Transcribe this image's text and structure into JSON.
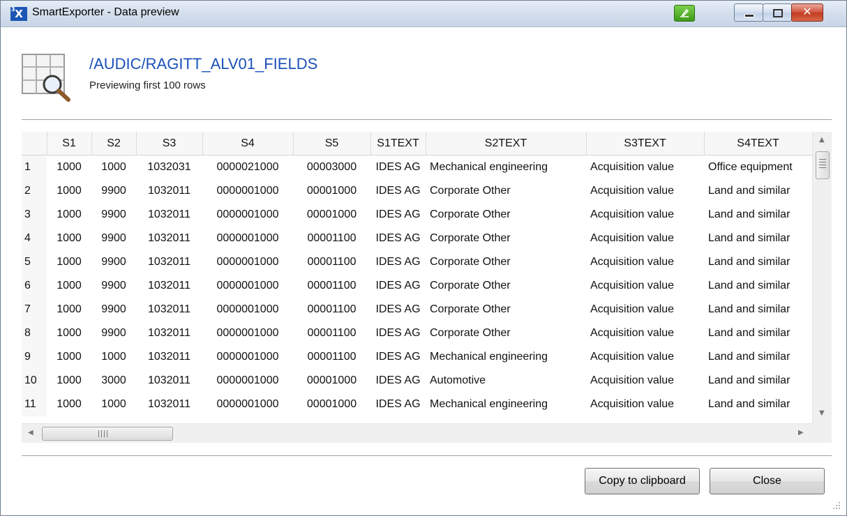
{
  "window": {
    "title": "SmartExporter - Data preview",
    "logo_text": "X",
    "logo_sup": "3",
    "close_glyph": "✕"
  },
  "header": {
    "title": "/AUDIC/RAGITT_ALV01_FIELDS",
    "subtitle": "Previewing first 100 rows"
  },
  "grid": {
    "columns": [
      "S1",
      "S2",
      "S3",
      "S4",
      "S5",
      "S1TEXT",
      "S2TEXT",
      "S3TEXT",
      "S4TEXT"
    ],
    "rows": [
      [
        "1",
        "1000",
        "1000",
        "1032031",
        "0000021000",
        "00003000",
        "IDES AG",
        "Mechanical engineering",
        "Acquisition value",
        "Office equipment"
      ],
      [
        "2",
        "1000",
        "9900",
        "1032011",
        "0000001000",
        "00001000",
        "IDES AG",
        "Corporate Other",
        "Acquisition value",
        "Land and similar"
      ],
      [
        "3",
        "1000",
        "9900",
        "1032011",
        "0000001000",
        "00001000",
        "IDES AG",
        "Corporate Other",
        "Acquisition value",
        "Land and similar"
      ],
      [
        "4",
        "1000",
        "9900",
        "1032011",
        "0000001000",
        "00001100",
        "IDES AG",
        "Corporate Other",
        "Acquisition value",
        "Land and similar"
      ],
      [
        "5",
        "1000",
        "9900",
        "1032011",
        "0000001000",
        "00001100",
        "IDES AG",
        "Corporate Other",
        "Acquisition value",
        "Land and similar"
      ],
      [
        "6",
        "1000",
        "9900",
        "1032011",
        "0000001000",
        "00001100",
        "IDES AG",
        "Corporate Other",
        "Acquisition value",
        "Land and similar"
      ],
      [
        "7",
        "1000",
        "9900",
        "1032011",
        "0000001000",
        "00001100",
        "IDES AG",
        "Corporate Other",
        "Acquisition value",
        "Land and similar"
      ],
      [
        "8",
        "1000",
        "9900",
        "1032011",
        "0000001000",
        "00001100",
        "IDES AG",
        "Corporate Other",
        "Acquisition value",
        "Land and similar"
      ],
      [
        "9",
        "1000",
        "1000",
        "1032011",
        "0000001000",
        "00001100",
        "IDES AG",
        "Mechanical engineering",
        "Acquisition value",
        "Land and similar"
      ],
      [
        "10",
        "1000",
        "3000",
        "1032011",
        "0000001000",
        "00001000",
        "IDES AG",
        "Automotive",
        "Acquisition value",
        "Land and similar"
      ],
      [
        "11",
        "1000",
        "1000",
        "1032011",
        "0000001000",
        "00001000",
        "IDES AG",
        "Mechanical engineering",
        "Acquisition value",
        "Land and similar"
      ]
    ]
  },
  "buttons": {
    "copy": "Copy to clipboard",
    "close": "Close"
  },
  "colors": {
    "title_blue": "#1a50b8",
    "close_red": "#c23a20",
    "pin_green": "#3e9a1a"
  },
  "icons": {
    "logo": "smartexporter-logo-icon",
    "pin": "pin-icon",
    "table_search": "table-search-icon"
  }
}
